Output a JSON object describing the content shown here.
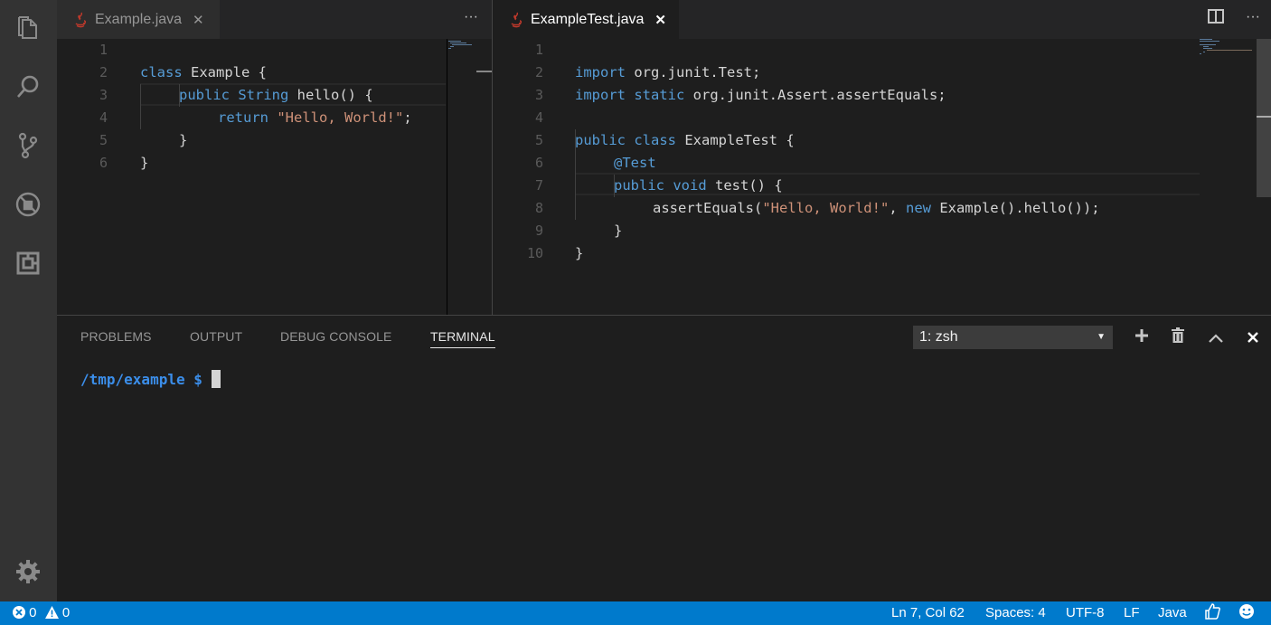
{
  "activity_bar": {
    "items": [
      "explorer-icon",
      "search-icon",
      "source-control-icon",
      "debug-icon",
      "extensions-icon"
    ],
    "settings": "gear-icon"
  },
  "editor_left": {
    "tab": {
      "label": "Example.java",
      "close": "✕"
    },
    "more": "···",
    "lines": [
      {
        "num": "1"
      },
      {
        "num": "2"
      },
      {
        "num": "3"
      },
      {
        "num": "4"
      },
      {
        "num": "5"
      },
      {
        "num": "6"
      }
    ],
    "code": {
      "l1_kw": "class",
      "l1_rest": " Example {",
      "l2_kw1": "public",
      "l2_kw2": "String",
      "l2_rest": " hello() {",
      "l3_kw": "return",
      "l3_str": "\"Hello, World!\"",
      "l3_end": ";",
      "l4": "}",
      "l5": "}"
    }
  },
  "editor_right": {
    "tab": {
      "label": "ExampleTest.java",
      "close": "✕"
    },
    "split": "split-editor-icon",
    "more": "···",
    "lines": [
      {
        "num": "1"
      },
      {
        "num": "2"
      },
      {
        "num": "3"
      },
      {
        "num": "4"
      },
      {
        "num": "5"
      },
      {
        "num": "6"
      },
      {
        "num": "7"
      },
      {
        "num": "8"
      },
      {
        "num": "9"
      },
      {
        "num": "10"
      }
    ],
    "code": {
      "l1_kw": "import",
      "l1_rest": " org.junit.Test;",
      "l2_kw1": "import",
      "l2_kw2": "static",
      "l2_rest": " org.junit.Assert.assertEquals;",
      "l4_kw1": "public",
      "l4_kw2": "class",
      "l4_rest": " ExampleTest {",
      "l5": "@Test",
      "l6_kw1": "public",
      "l6_kw2": "void",
      "l6_rest": " test() {",
      "l7_a": "assertEquals(",
      "l7_str": "\"Hello, World!\"",
      "l7_b": ", ",
      "l7_kw": "new",
      "l7_c": " Example().hello());",
      "l8": "}",
      "l9": "}"
    }
  },
  "panel": {
    "tabs": [
      "PROBLEMS",
      "OUTPUT",
      "DEBUG CONSOLE",
      "TERMINAL"
    ],
    "active_tab": "TERMINAL",
    "terminal_select": "1: zsh",
    "prompt": "/tmp/example $"
  },
  "status_bar": {
    "errors": "0",
    "warnings": "0",
    "position": "Ln 7, Col 62",
    "spaces": "Spaces: 4",
    "encoding": "UTF-8",
    "eol": "LF",
    "language": "Java"
  },
  "colors": {
    "status_bg": "#007acc",
    "activity_bg": "#333333",
    "editor_bg": "#1e1e1e",
    "keyword": "#569cd6",
    "string": "#ce9178",
    "prompt": "#3b8eea"
  }
}
